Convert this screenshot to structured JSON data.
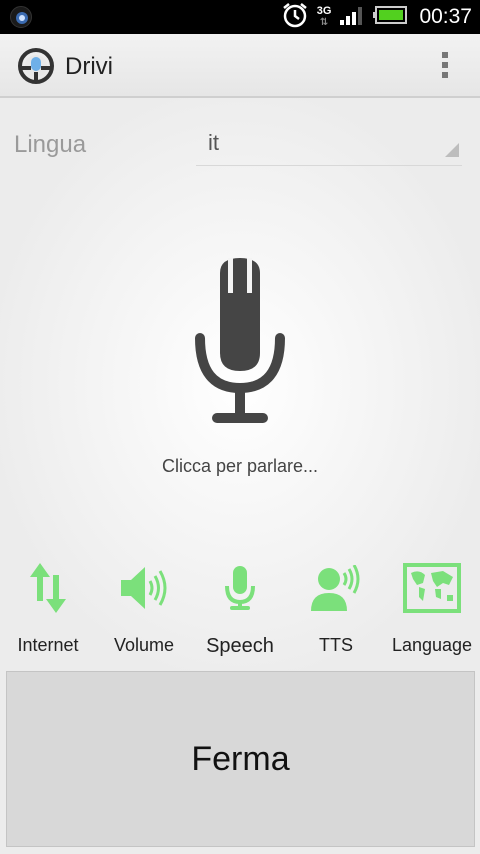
{
  "status_bar": {
    "time": "00:37",
    "network": "3G",
    "icons": [
      "app-notification-icon",
      "alarm-icon",
      "3g-icon",
      "signal-icon",
      "battery-icon"
    ]
  },
  "action_bar": {
    "title": "Drivi",
    "logo": "steering-wheel-icon",
    "overflow": "overflow-menu-icon"
  },
  "language": {
    "label": "Lingua",
    "selected": "it"
  },
  "mic": {
    "icon": "microphone-icon",
    "hint": "Clicca per parlare..."
  },
  "indicators": [
    {
      "label": "Internet",
      "icon": "data-arrows-icon"
    },
    {
      "label": "Volume",
      "icon": "speaker-icon"
    },
    {
      "label": "Speech",
      "icon": "microphone-icon"
    },
    {
      "label": "TTS",
      "icon": "talking-head-icon"
    },
    {
      "label": "Language",
      "icon": "world-map-icon"
    }
  ],
  "stop_button": {
    "label": "Ferma"
  },
  "colors": {
    "indicator_green": "#7be07b",
    "mic_dark": "#454545",
    "battery_green": "#52d01f"
  }
}
